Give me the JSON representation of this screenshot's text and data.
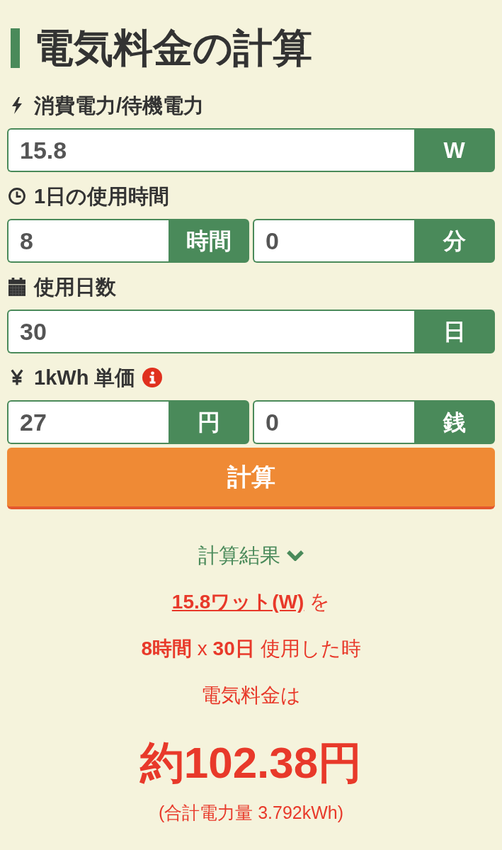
{
  "title": "電気料金の計算",
  "fields": [
    {
      "label": "消費電力/待機電力",
      "info": false,
      "inputs": [
        {
          "value": "15.8",
          "unit": "W"
        }
      ]
    },
    {
      "label": "1日の使用時間",
      "info": false,
      "inputs": [
        {
          "value": "8",
          "unit": "時間"
        },
        {
          "value": "0",
          "unit": "分"
        }
      ]
    },
    {
      "label": "使用日数",
      "info": false,
      "inputs": [
        {
          "value": "30",
          "unit": "日"
        }
      ]
    },
    {
      "label": "1kWh 単価",
      "info": true,
      "inputs": [
        {
          "value": "27",
          "unit": "円"
        },
        {
          "value": "0",
          "unit": "銭"
        }
      ]
    }
  ],
  "calculate_button": "計算",
  "result": {
    "heading": "計算結果",
    "power_link": "15.8ワット(W)",
    "power_suffix": "を",
    "usage_line": "**8時間** x **30日** 使用した時",
    "cost_intro": "電気料金は",
    "cost": "約102.38円",
    "total_energy": "(合計電力量 3.792kWh)"
  }
}
